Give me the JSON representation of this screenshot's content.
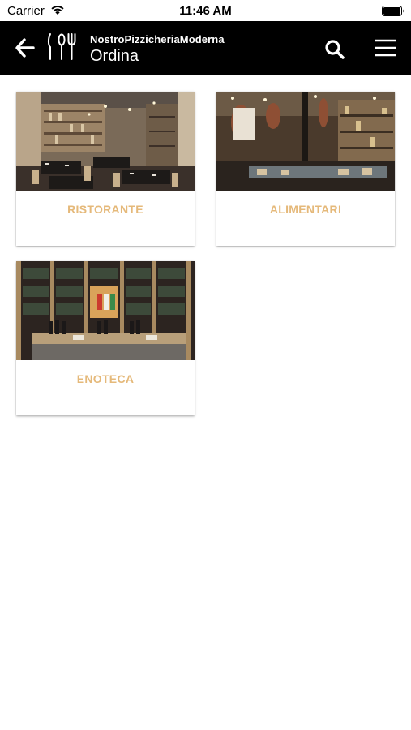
{
  "status_bar": {
    "carrier": "Carrier",
    "time": "11:46 AM"
  },
  "header": {
    "brand": "NostroPizzicheriaModerna",
    "title": "Ordina",
    "icons": [
      "back-arrow-icon",
      "cutlery-icon",
      "search-icon",
      "hamburger-menu-icon"
    ]
  },
  "categories": [
    {
      "label": "RISTORANTE"
    },
    {
      "label": "ALIMENTARI"
    },
    {
      "label": "ENOTECA"
    }
  ],
  "colors": {
    "header_bg": "#000000",
    "label_accent": "#e5b97a",
    "background": "#ffffff"
  }
}
